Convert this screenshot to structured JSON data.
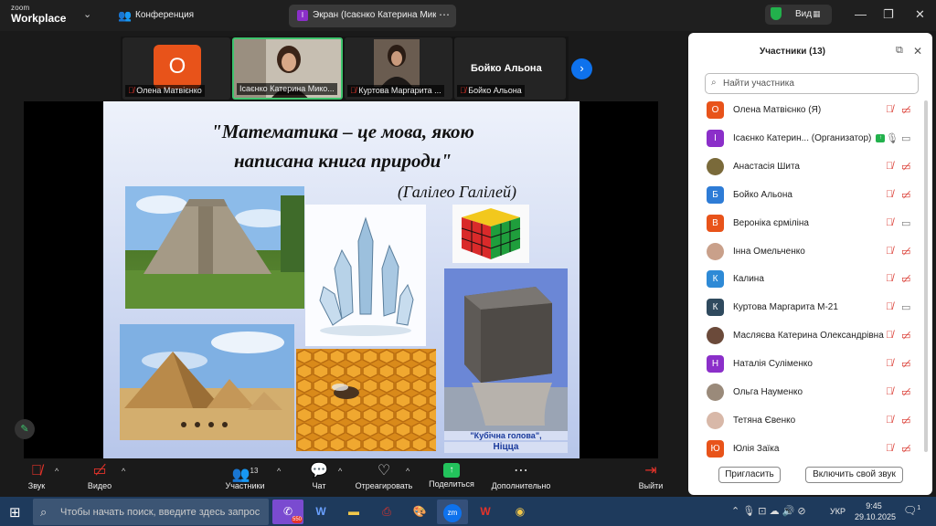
{
  "topbar": {
    "logo_line1": "zoom",
    "logo_line2": "Workplace",
    "meeting_label": "Конференция",
    "screen_tab_badge": "I",
    "screen_tab_title": "Экран (Ісаєнко Катерина Микол",
    "view_label": "Вид"
  },
  "thumbnails": [
    {
      "avatar_letter": "О",
      "name": "Олена Матвієнко"
    },
    {
      "name": "Ісаєнко Катерина Мико..."
    },
    {
      "name": "Куртова Маргарита ..."
    },
    {
      "display_name": "Бойко Альона",
      "name": "Бойко Альона"
    }
  ],
  "slide": {
    "quote_line1": "\"Математика – це мова, якою",
    "quote_line2": "написана книга природи\"",
    "author": "(Галілео Галілей)",
    "cube_caption_line1": "\"Кубічна голова\",",
    "cube_caption_line2": "Ніцца"
  },
  "toolbar": {
    "audio": "Звук",
    "video": "Видео",
    "participants": "Участники",
    "participants_count": "13",
    "chat": "Чат",
    "react": "Отреагировать",
    "share": "Поделиться",
    "more": "Дополнительно",
    "leave": "Выйти"
  },
  "panel": {
    "title": "Участники (13)",
    "search_placeholder": "Найти участника",
    "invite": "Пригласить",
    "unmute_self": "Включить свой звук",
    "participants": [
      {
        "letter": "О",
        "color": "#e8531a",
        "name": "Олена Матвієнко (Я)",
        "mic": "muted",
        "cam": "off"
      },
      {
        "letter": "І",
        "color": "#8b2fc9",
        "name": "Ісаєнко Катерин... (Организатор)",
        "mic": "on",
        "cam": "on",
        "host": true
      },
      {
        "letter": "",
        "color": "#7a6a3a",
        "name": "Анастасія Шита",
        "mic": "muted",
        "cam": "off",
        "photo": true
      },
      {
        "letter": "Б",
        "color": "#2e7cd6",
        "name": "Бойко Альона",
        "mic": "muted",
        "cam": "off"
      },
      {
        "letter": "В",
        "color": "#e8531a",
        "name": "Вероніка єрміліна",
        "mic": "muted",
        "cam": "on"
      },
      {
        "letter": "",
        "color": "#c9a08a",
        "name": "Інна Омельченко",
        "mic": "muted",
        "cam": "off",
        "photo": true
      },
      {
        "letter": "К",
        "color": "#2e8ad6",
        "name": "Калина",
        "mic": "muted",
        "cam": "off"
      },
      {
        "letter": "К",
        "color": "#2f4a5e",
        "name": "Куртова Маргарита М-21",
        "mic": "muted",
        "cam": "on"
      },
      {
        "letter": "",
        "color": "#6b4a3a",
        "name": "Масляєва Катерина Олександрівна",
        "mic": "muted",
        "cam": "off",
        "photo": true
      },
      {
        "letter": "Н",
        "color": "#8b2fc9",
        "name": "Наталія Суліменко",
        "mic": "muted",
        "cam": "off"
      },
      {
        "letter": "",
        "color": "#9a8a7a",
        "name": "Ольга Науменко",
        "mic": "muted",
        "cam": "off",
        "photo": true
      },
      {
        "letter": "",
        "color": "#d8b8a8",
        "name": "Тетяна Євенко",
        "mic": "muted",
        "cam": "off",
        "photo": true
      },
      {
        "letter": "Ю",
        "color": "#e8531a",
        "name": "Юлія Заїка",
        "mic": "muted",
        "cam": "off"
      }
    ]
  },
  "taskbar": {
    "search_placeholder": "Чтобы начать поиск, введите здесь запрос",
    "viber_badge": "550",
    "language": "УКР",
    "time": "9:45",
    "date": "29.10.2025",
    "notifications": "1"
  }
}
